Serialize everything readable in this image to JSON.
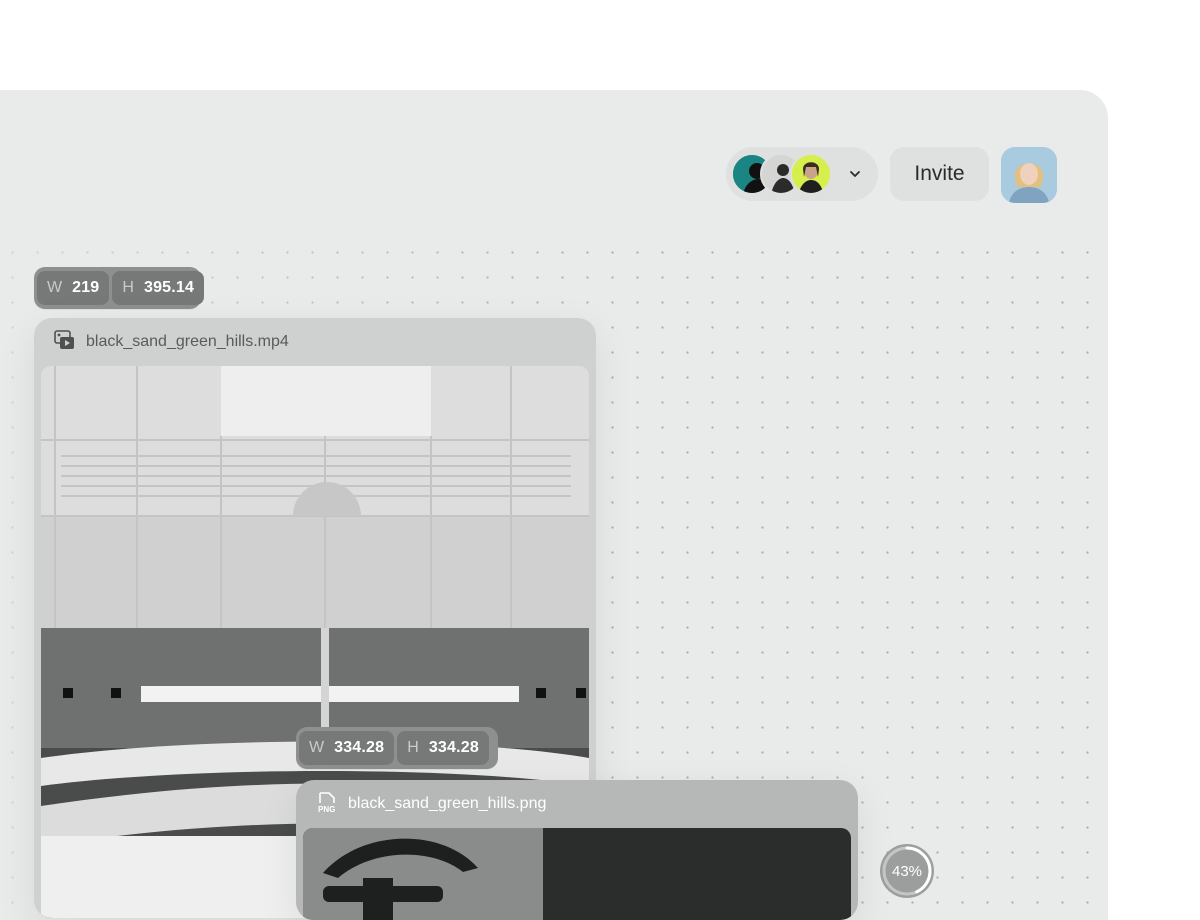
{
  "header": {
    "collaborators": [
      {
        "name": "collaborator-1",
        "color": "#1e8c8a"
      },
      {
        "name": "collaborator-2",
        "color": "#cfd0ce"
      },
      {
        "name": "collaborator-3",
        "color": "#d8f04a"
      }
    ],
    "dropdown_icon": "chevron-down-icon",
    "invite_label": "Invite",
    "user_avatar_color": "#a7c9df"
  },
  "video_card": {
    "dimensions": {
      "w_key": "W",
      "w_value": "219",
      "h_key": "H",
      "h_value": "395.14"
    },
    "file_icon": "video-file-icon",
    "filename": "black_sand_green_hills.mp4"
  },
  "image_card": {
    "dimensions": {
      "w_key": "W",
      "w_value": "334.28",
      "h_key": "H",
      "h_value": "334.28"
    },
    "file_icon": "png-file-icon",
    "file_icon_text": "PNG",
    "filename": "black_sand_green_hills.png"
  },
  "upload": {
    "progress_label": "43%",
    "progress": 0.43
  },
  "colors": {
    "canvas_bg": "#e9ebea",
    "card_bg": "#cfd0d0",
    "badge_bg": "#8e9090"
  }
}
